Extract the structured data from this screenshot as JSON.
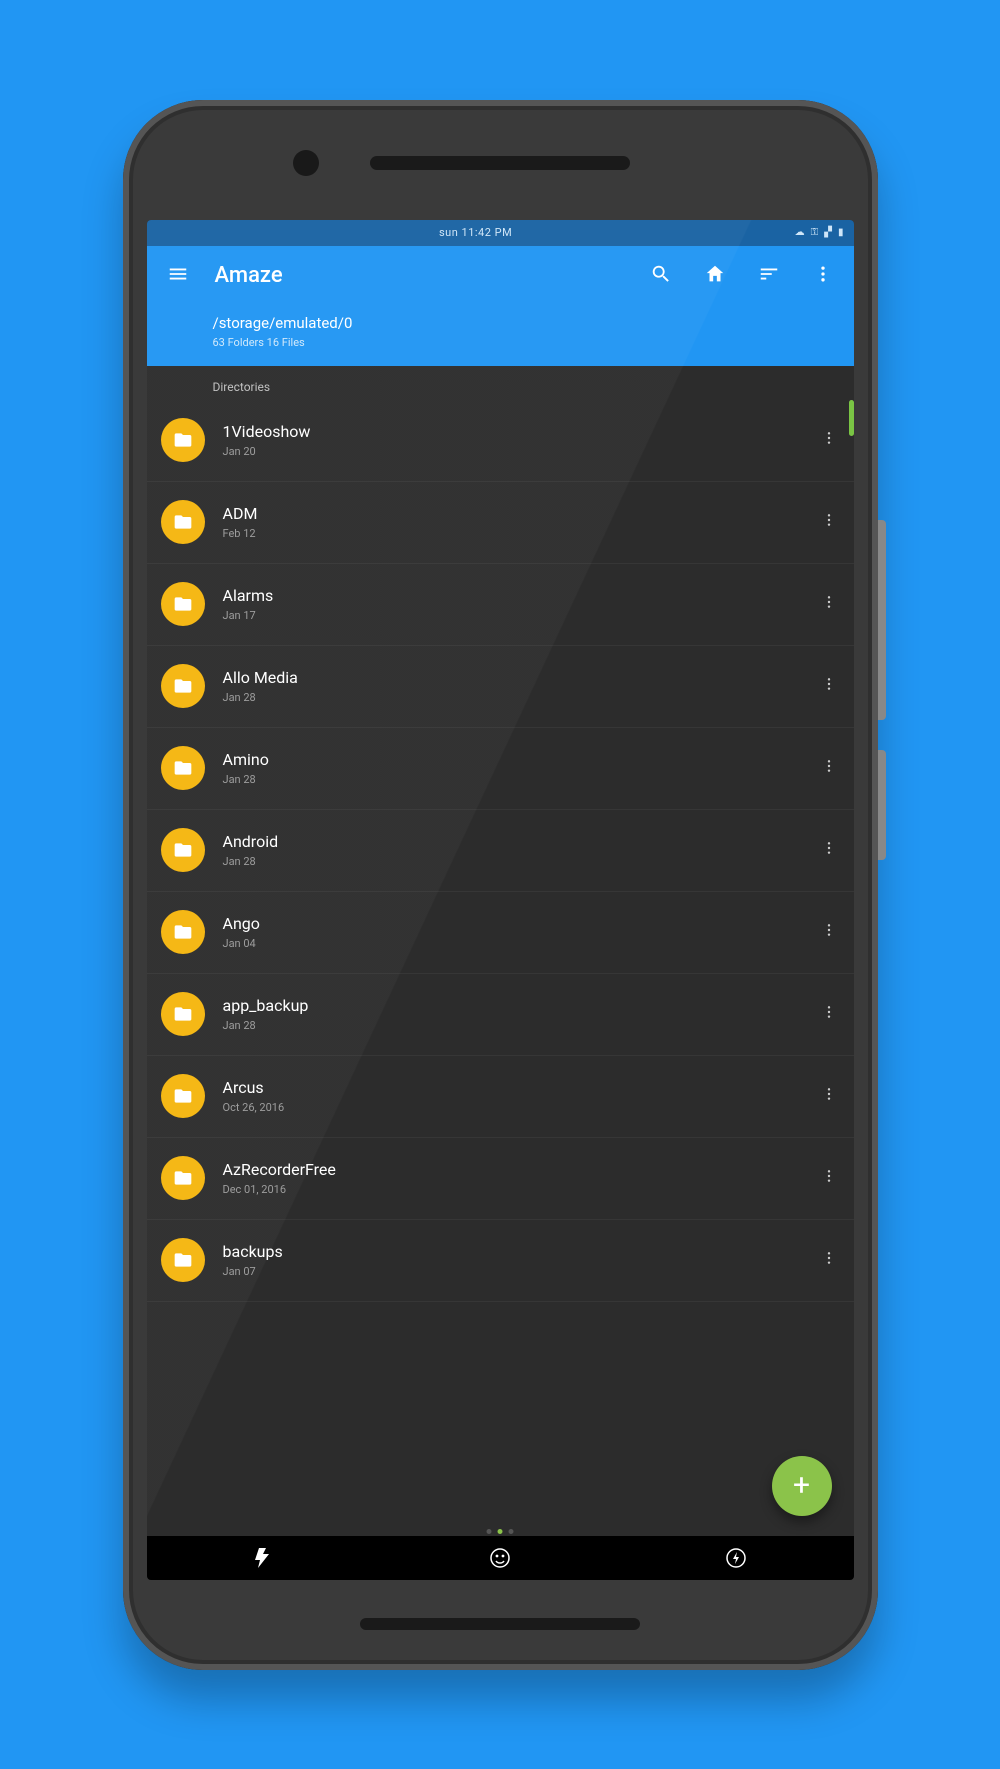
{
  "statusbar": {
    "time": "sun 11:42 PM",
    "icons": [
      "cloud",
      "key",
      "signal",
      "battery"
    ]
  },
  "appbar": {
    "title": "Amaze"
  },
  "pathbar": {
    "path": "/storage/emulated/0",
    "counts": "63 Folders 16 Files"
  },
  "section": {
    "directories_label": "Directories"
  },
  "folders": [
    {
      "name": "1Videoshow",
      "date": "Jan 20"
    },
    {
      "name": "ADM",
      "date": "Feb 12"
    },
    {
      "name": "Alarms",
      "date": "Jan 17"
    },
    {
      "name": "Allo Media",
      "date": "Jan 28"
    },
    {
      "name": "Amino",
      "date": "Jan 28"
    },
    {
      "name": "Android",
      "date": "Jan 28"
    },
    {
      "name": "Ango",
      "date": "Jan 04"
    },
    {
      "name": "app_backup",
      "date": "Jan 28"
    },
    {
      "name": "Arcus",
      "date": "Oct 26, 2016"
    },
    {
      "name": "AzRecorderFree",
      "date": "Dec 01, 2016"
    },
    {
      "name": "backups",
      "date": "Jan 07"
    }
  ],
  "fab": {
    "label": "+"
  },
  "colors": {
    "primary": "#2196f3",
    "accent": "#8bc34a",
    "folder": "#f5b60e",
    "background_dark": "#2c2c2c"
  }
}
